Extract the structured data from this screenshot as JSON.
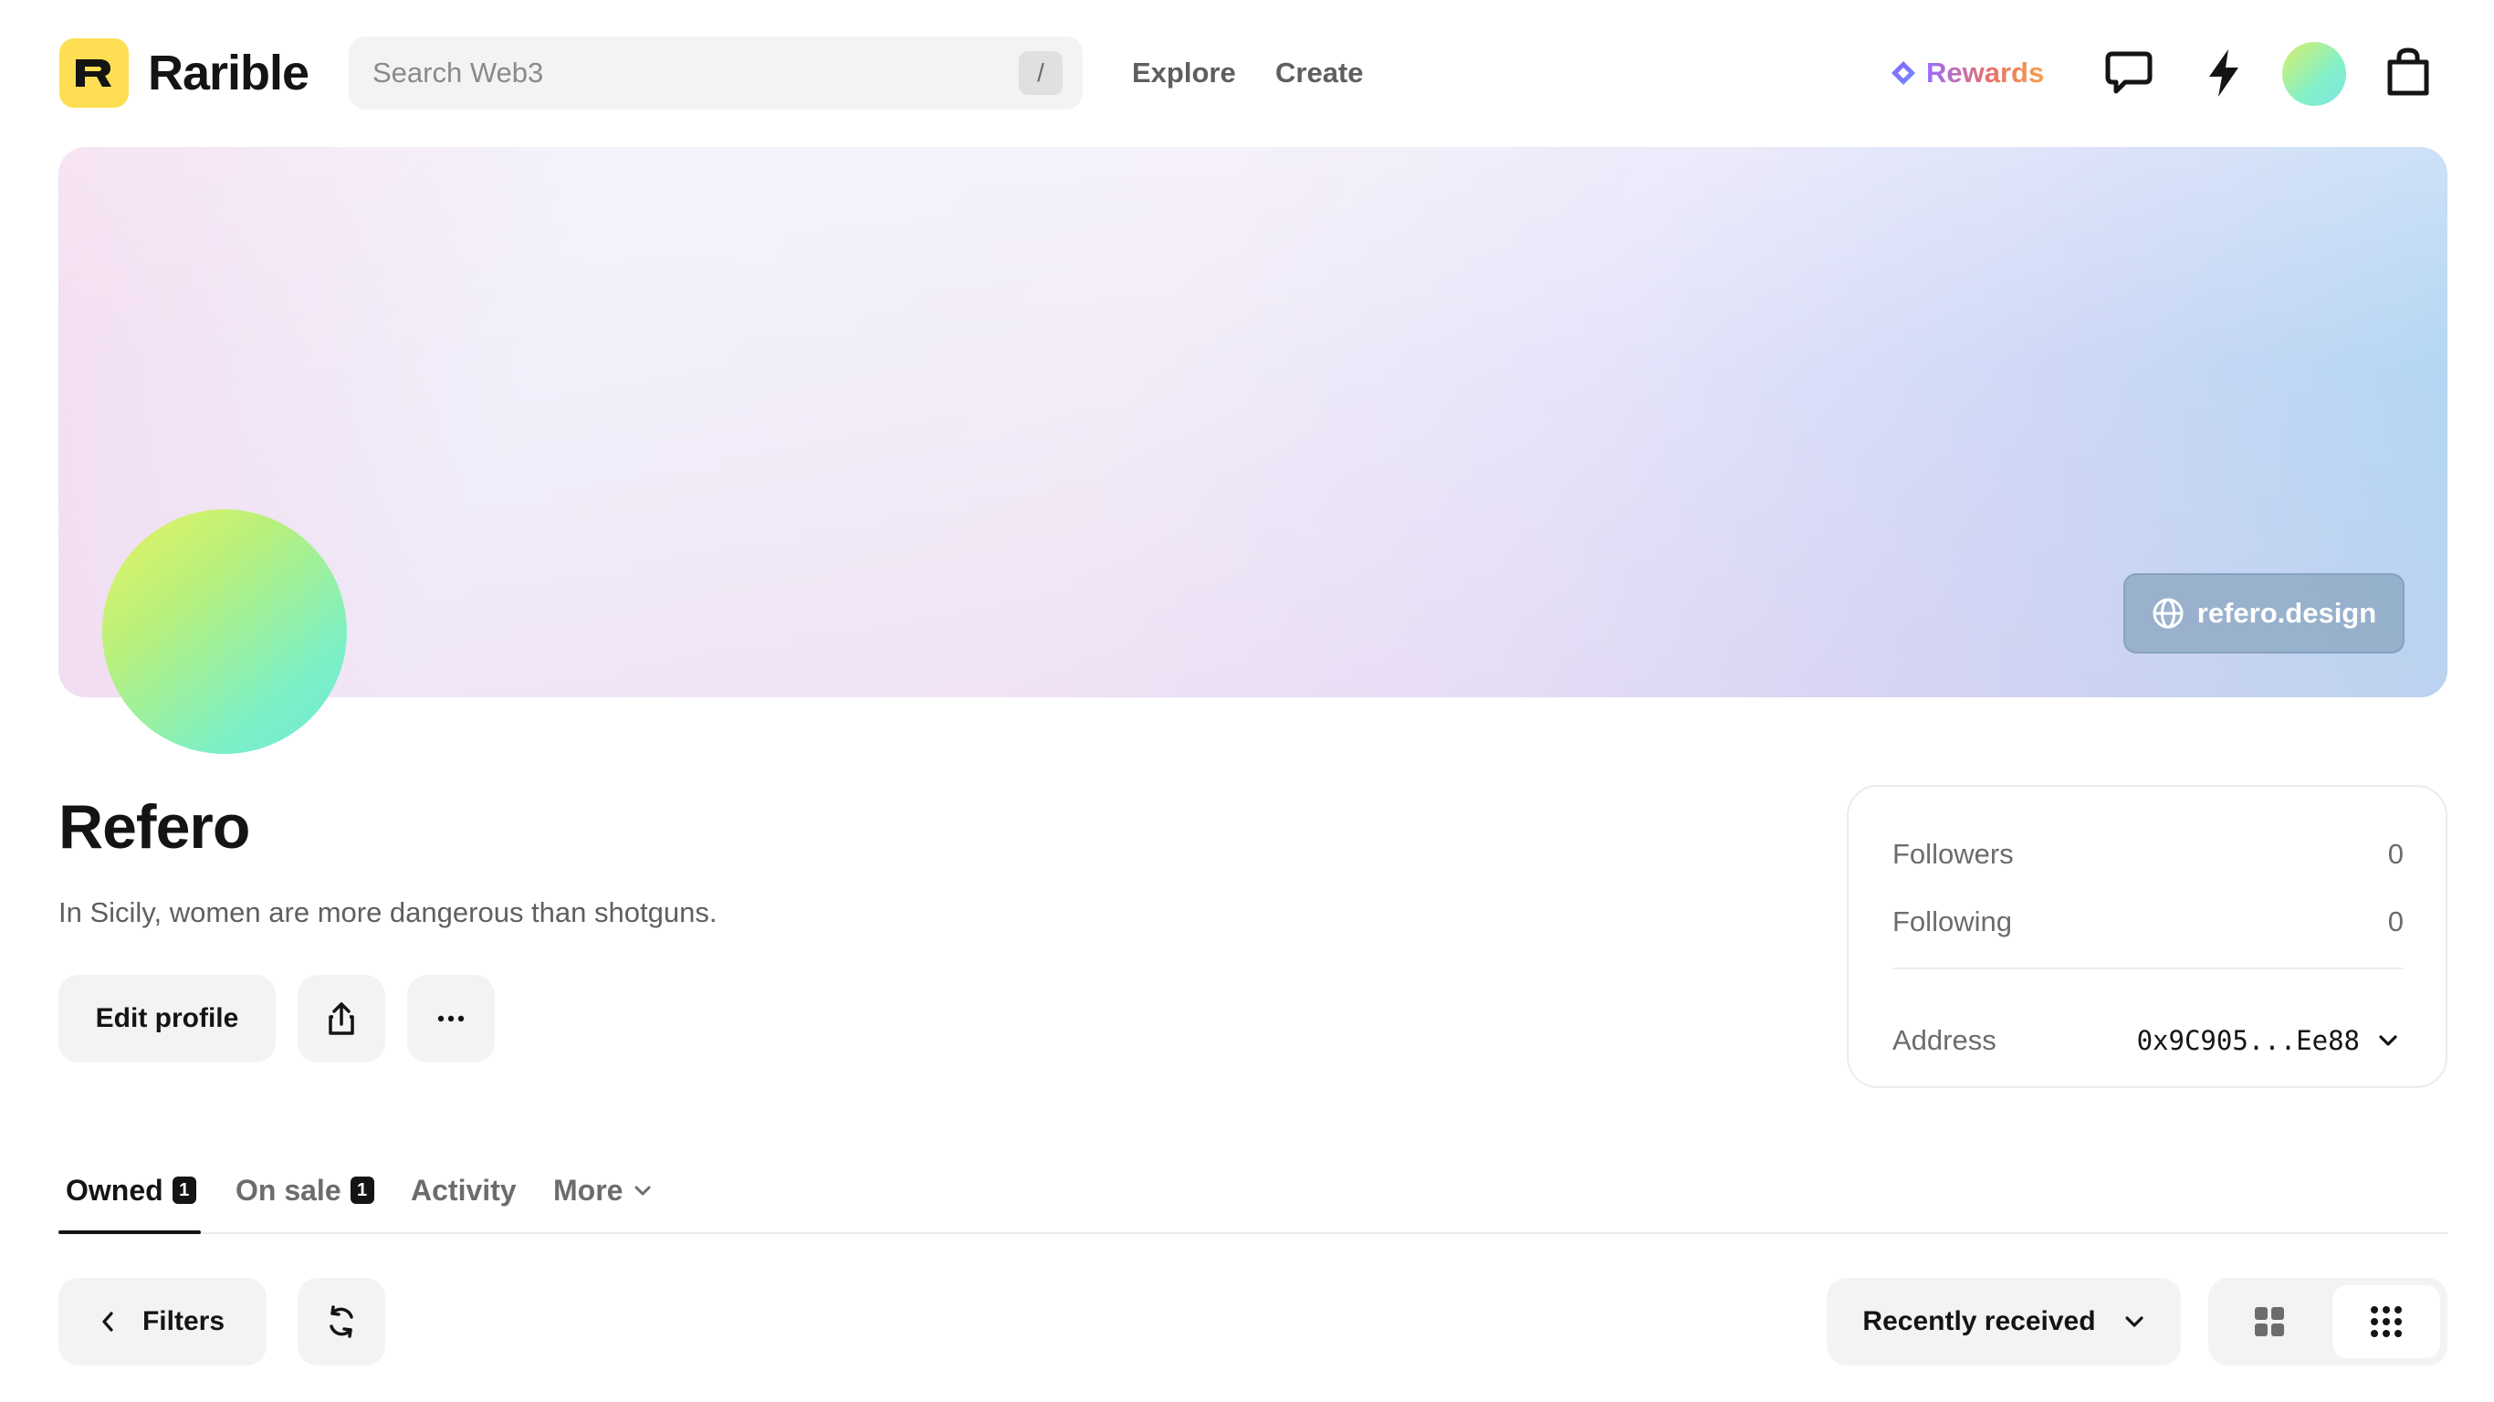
{
  "header": {
    "logo_letter": "R",
    "logo_text": "Rarible",
    "search": {
      "placeholder": "Search Web3",
      "shortcut": "/"
    },
    "nav": [
      {
        "label": "Explore"
      },
      {
        "label": "Create"
      }
    ],
    "rewards_label": "Rewards",
    "icons": [
      "chat-icon",
      "lightning-icon",
      "avatar",
      "bag-icon"
    ]
  },
  "cover": {
    "website_label": "refero.design"
  },
  "profile": {
    "name": "Refero",
    "bio": "In Sicily, women are more dangerous than shotguns.",
    "edit_label": "Edit profile",
    "share_icon": "share-icon",
    "more_icon": "more-dots-icon"
  },
  "stats": {
    "followers_label": "Followers",
    "followers_value": "0",
    "following_label": "Following",
    "following_value": "0",
    "address_label": "Address",
    "address_value": "0x9C905...Ee88"
  },
  "tabs": [
    {
      "label": "Owned",
      "count": "1",
      "active": true
    },
    {
      "label": "On sale",
      "count": "1",
      "active": false
    },
    {
      "label": "Activity",
      "active": false
    },
    {
      "label": "More",
      "active": false
    }
  ],
  "toolbar": {
    "filters_label": "Filters",
    "sort_label": "Recently received",
    "view_modes": [
      "large-grid-icon",
      "small-grid-icon"
    ],
    "active_view": "small-grid-icon"
  },
  "colors": {
    "accent_yellow": "#fedf54",
    "text_primary": "#141414",
    "text_secondary": "#6c6c6c",
    "surface": "#f3f3f3"
  }
}
